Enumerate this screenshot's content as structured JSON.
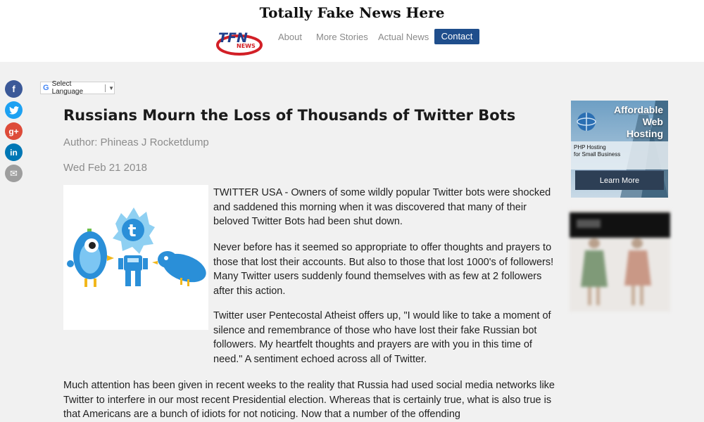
{
  "site": {
    "title": "Totally Fake News Here",
    "logo_text": "TFN",
    "logo_sub": "NEWS"
  },
  "nav": {
    "items": [
      {
        "label": "About"
      },
      {
        "label": "More Stories"
      },
      {
        "label": "Actual News"
      }
    ],
    "contact_label": "Contact"
  },
  "social": [
    {
      "icon": "facebook-icon",
      "glyph": "f",
      "color": "#3b5998"
    },
    {
      "icon": "twitter-icon",
      "glyph": "t",
      "color": "#1da1f2"
    },
    {
      "icon": "googleplus-icon",
      "glyph": "g+",
      "color": "#dd4b39"
    },
    {
      "icon": "linkedin-icon",
      "glyph": "in",
      "color": "#0077b5"
    },
    {
      "icon": "email-icon",
      "glyph": "✉",
      "color": "#9e9e9e"
    }
  ],
  "translate": {
    "label": "Select Language",
    "arrow": "▼"
  },
  "article": {
    "title": "Russians Mourn the Loss of Thousands of Twitter Bots",
    "author": "Author: Phineas J Rocketdump",
    "date": "Wed Feb 21 2018",
    "p1": "TWITTER USA - Owners of some wildly popular Twitter bots were shocked and saddened this morning when it was discovered that many of their beloved Twitter Bots had been shut down.",
    "p2": "Never before has it seemed so appropriate to offer thoughts and prayers to those that lost their accounts. But also to those that lost 1000's of followers! Many Twitter users suddenly found themselves with as few at 2 followers after this action.",
    "p3": "Twitter user Pentecostal Atheist offers up, \"I would like to take a moment of silence and remembrance of those who have lost their fake Russian bot followers. My heartfelt thoughts and prayers are with you in this time of need.\" A sentiment echoed across all of Twitter.",
    "p4": "Much attention has been given in recent weeks to the reality that Russia had used social media networks like Twitter to interfere in our most recent Presidential election. Whereas that is certainly true, what is also true is that Americans are a bunch of idiots for not noticing. Now that a number of the offending"
  },
  "ads": {
    "host_line1": "Affordable",
    "host_line2": "Web",
    "host_line3": "Hosting",
    "host_sub1": "PHP Hosting",
    "host_sub2": "for Small Business",
    "host_button": "Learn More"
  }
}
